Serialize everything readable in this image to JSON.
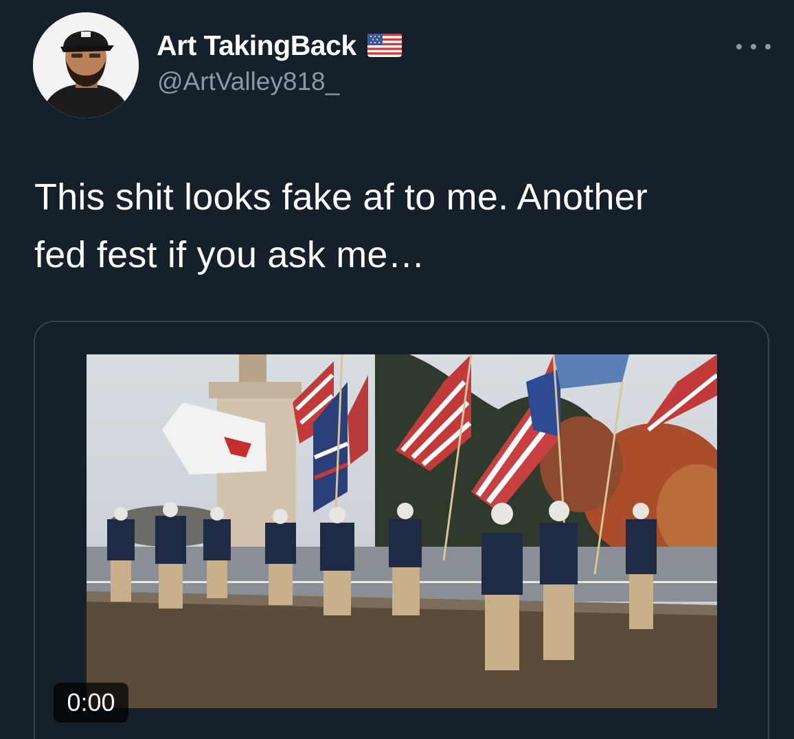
{
  "tweet": {
    "display_name": "Art TakingBack",
    "flag": "us-flag-emoji",
    "handle": "@ArtValley818_",
    "more_icon": "more-horizontal-icon",
    "text_line1": "This shit looks fake af to me. Another",
    "text_line2": "fed fest if you ask me…"
  },
  "media": {
    "type": "video",
    "timestamp": "0:00"
  },
  "colors": {
    "background": "#15202b",
    "secondary_text": "#8b98a5",
    "border": "#38444d",
    "primary_text": "#ffffff"
  }
}
